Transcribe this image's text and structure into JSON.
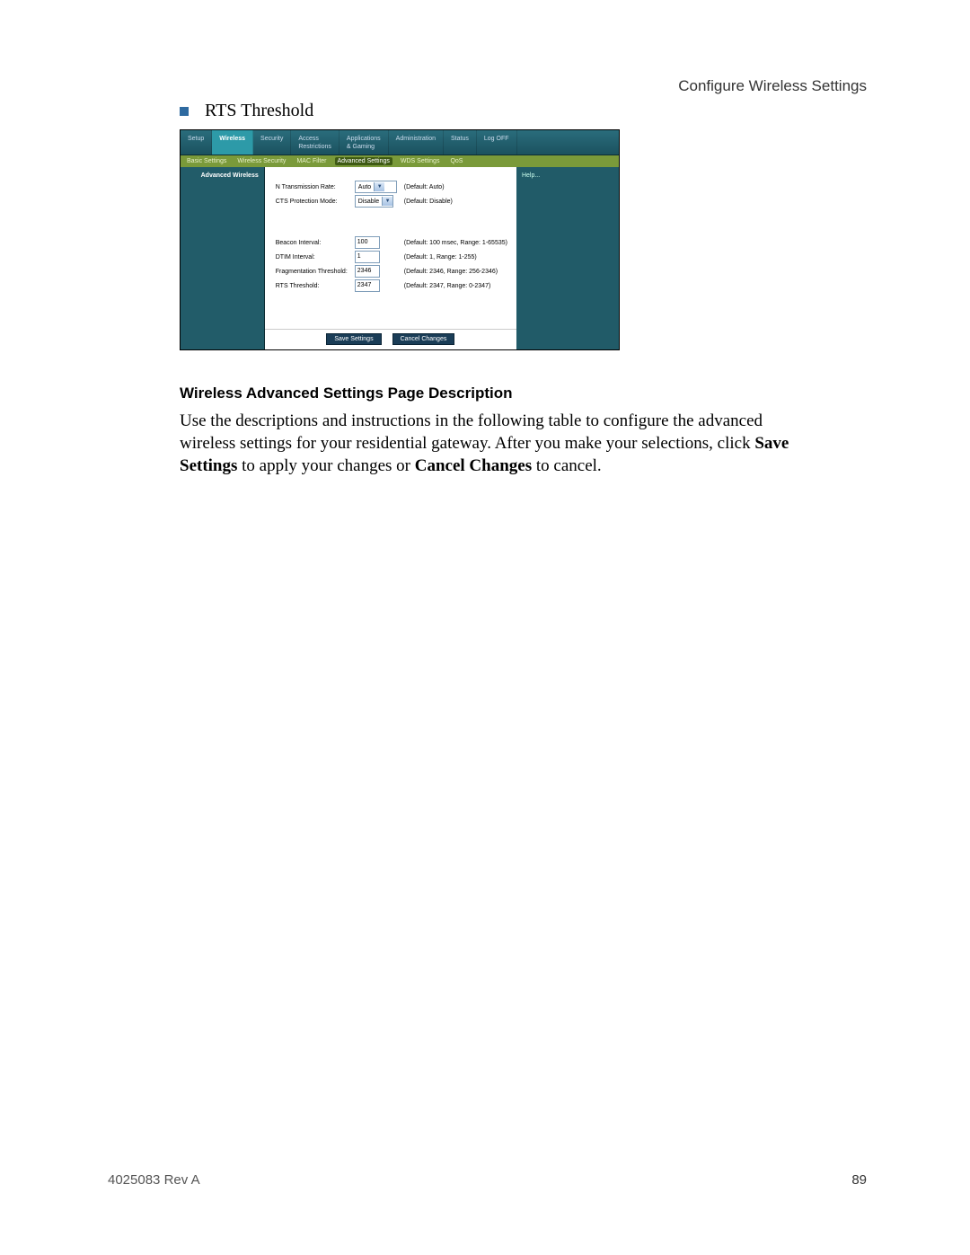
{
  "header": {
    "right": "Configure Wireless Settings"
  },
  "bullet": {
    "text": "RTS Threshold"
  },
  "router": {
    "tabs": [
      "Setup",
      "Wireless",
      "Security",
      "Access\nRestrictions",
      "Applications\n& Gaming",
      "Administration",
      "Status",
      "Log OFF"
    ],
    "active_tab": 1,
    "subtabs": [
      "Basic Settings",
      "Wireless Security",
      "MAC Filter",
      "Advanced Settings",
      "WDS Settings",
      "QoS"
    ],
    "active_subtab": 3,
    "left_title": "Advanced Wireless",
    "help_label": "Help...",
    "fields": {
      "n_rate_label": "N Transmission Rate:",
      "n_rate_value": "Auto",
      "n_rate_hint": "(Default: Auto)",
      "cts_label": "CTS Protection Mode:",
      "cts_value": "Disable",
      "cts_hint": "(Default: Disable)",
      "beacon_label": "Beacon Interval:",
      "beacon_value": "100",
      "beacon_hint": "(Default: 100 msec, Range: 1-65535)",
      "dtim_label": "DTIM Interval:",
      "dtim_value": "1",
      "dtim_hint": "(Default: 1, Range: 1-255)",
      "frag_label": "Fragmentation Threshold:",
      "frag_value": "2346",
      "frag_hint": "(Default: 2346, Range: 256-2346)",
      "rts_label": "RTS Threshold:",
      "rts_value": "2347",
      "rts_hint": "(Default: 2347, Range: 0-2347)"
    },
    "buttons": {
      "save": "Save Settings",
      "cancel": "Cancel Changes"
    }
  },
  "section_heading": "Wireless Advanced Settings Page Description",
  "paragraph": {
    "p1a": "Use the descriptions and instructions in the following table to configure the advanced wireless settings for your residential gateway. After you make your selections, click ",
    "p1b": "Save Settings",
    "p1c": " to apply your changes or ",
    "p1d": "Cancel Changes",
    "p1e": " to cancel."
  },
  "footer": {
    "left": "4025083 Rev A",
    "right": "89"
  }
}
